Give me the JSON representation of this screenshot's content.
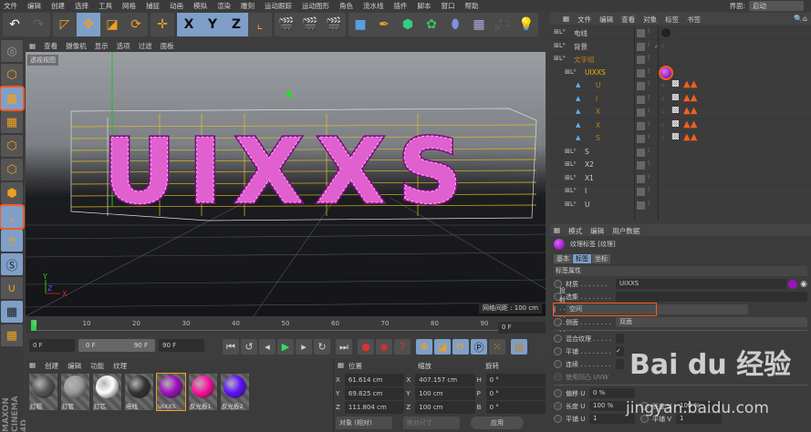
{
  "menu": [
    "文件",
    "编辑",
    "创建",
    "选择",
    "工具",
    "网格",
    "捕捉",
    "动画",
    "模拟",
    "渲染",
    "雕刻",
    "运动跟踪",
    "运动图形",
    "角色",
    "流水线",
    "插件",
    "脚本",
    "窗口",
    "帮助"
  ],
  "interface": {
    "label": "界面:",
    "value": "启动"
  },
  "toolbar": {
    "x": "X",
    "y": "Y",
    "z": "Z"
  },
  "viewport": {
    "menu": [
      "查看",
      "摄像机",
      "显示",
      "选项",
      "过滤",
      "面板"
    ],
    "label": "透视视图",
    "grid_info": "网格间距 : 100 cm",
    "scene_text": "UIXXS"
  },
  "timeline": {
    "ticks": [
      "0",
      "10",
      "20",
      "30",
      "40",
      "50",
      "60",
      "70",
      "80",
      "90"
    ],
    "current": "0 F",
    "start": "0 F",
    "range_start": "0 F",
    "range_end": "90 F",
    "end": "90 F",
    "current_marker": 0
  },
  "materials": {
    "menu": [
      "创建",
      "编辑",
      "功能",
      "纹理"
    ],
    "items": [
      {
        "name": "灯帽",
        "color": "#555"
      },
      {
        "name": "灯管",
        "color": "#999"
      },
      {
        "name": "灯芯",
        "color": "#ffffff"
      },
      {
        "name": "电线",
        "color": "#333"
      },
      {
        "name": "UIXXS",
        "color": "#a010c0"
      },
      {
        "name": "反光板1",
        "color": "#ff10a0"
      },
      {
        "name": "反光板2",
        "color": "#6010ff"
      }
    ]
  },
  "brand": "MAXON CINEMA 4D",
  "coords": {
    "headers": [
      "位置",
      "缩放",
      "旋转"
    ],
    "pos": [
      {
        "axis": "X",
        "v": "61.614 cm"
      },
      {
        "axis": "Y",
        "v": "69.825 cm"
      },
      {
        "axis": "Z",
        "v": "111.804 cm"
      }
    ],
    "scale": [
      {
        "axis": "X",
        "v": "407.157 cm"
      },
      {
        "axis": "Y",
        "v": "100 cm"
      },
      {
        "axis": "Z",
        "v": "100 cm"
      }
    ],
    "rot": [
      {
        "axis": "H",
        "v": "0 °"
      },
      {
        "axis": "P",
        "v": "0 °"
      },
      {
        "axis": "B",
        "v": "0 °"
      }
    ],
    "mode": "对象 (相对)",
    "size": "绝对尺寸",
    "apply": "应用"
  },
  "objects": {
    "menu": [
      "文件",
      "编辑",
      "查看",
      "对象",
      "标签",
      "书签"
    ],
    "rows": [
      {
        "name": "电线",
        "level": 0,
        "color": "#ccc"
      },
      {
        "name": "背景",
        "level": 0,
        "color": "#ccc"
      },
      {
        "name": "文字组",
        "level": 0,
        "color": "#c08020"
      },
      {
        "name": "UIXXS",
        "level": 1,
        "color": "#f0b000"
      },
      {
        "name": "U",
        "level": 2,
        "color": "#c08020"
      },
      {
        "name": "I",
        "level": 2,
        "color": "#c08020"
      },
      {
        "name": "X",
        "level": 2,
        "color": "#c08020"
      },
      {
        "name": "X",
        "level": 2,
        "color": "#c08020"
      },
      {
        "name": "S",
        "level": 2,
        "color": "#c08020"
      },
      {
        "name": "S",
        "level": 1,
        "color": "#ccc"
      },
      {
        "name": "X2",
        "level": 1,
        "color": "#ccc"
      },
      {
        "name": "X1",
        "level": 1,
        "color": "#ccc"
      },
      {
        "name": "I",
        "level": 1,
        "color": "#ccc"
      },
      {
        "name": "U",
        "level": 1,
        "color": "#ccc"
      }
    ]
  },
  "attributes": {
    "menu": [
      "模式",
      "编辑",
      "用户数据"
    ],
    "title": "纹理标签 [纹理]",
    "tabs": [
      "基本",
      "标签",
      "坐标"
    ],
    "section": "标签属性",
    "material_label": "材质 . . . . . . .",
    "material": "UIXXS",
    "selection_label": "选集 . . . . . . . .",
    "projection_label": "投射 . . . . . . . .",
    "projection": "空间",
    "side_label": "侧面 . . . . . . . .",
    "side": "双面",
    "mix_label": "混合纹理 . . . . .",
    "tile_label": "平铺 . . . . . . . .",
    "seamless_label": "连续 . . . . . . . .",
    "uvw_label": "使用凹凸 UVW",
    "offset_u_label": "偏移 U",
    "offset_u": "0 %",
    "length_u_label": "长度 U",
    "length_u": "100 %",
    "length_v_label": "长度 V",
    "length_v": "100 %",
    "tiles_u_label": "平铺 U",
    "tiles_u": "1",
    "tiles_v_label": "平铺 V",
    "tiles_v": "1"
  },
  "watermark": {
    "logo": "Bai du 经验",
    "url": "jingyan.baidu.com"
  }
}
